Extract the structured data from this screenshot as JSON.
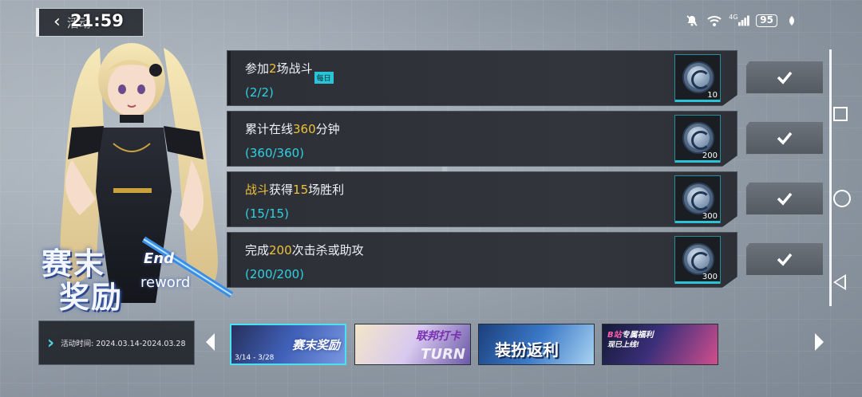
{
  "header": {
    "title": "活动",
    "time": "21:59"
  },
  "status_bar": {
    "battery": "95",
    "network": "4G",
    "icons": [
      "mute-bell-icon",
      "wifi-icon",
      "signal-icon",
      "battery-icon",
      "leaf-icon"
    ]
  },
  "event_title": {
    "line1": "赛末",
    "line2": "奖励",
    "en_end": "End",
    "en_reward": "reword"
  },
  "activity": {
    "label": "活动时间: 2024.03.14-2024.03.28"
  },
  "tasks": [
    {
      "name_parts": [
        "参加",
        "2",
        "场战斗"
      ],
      "daily_tag": "每日",
      "progress": "(2/2)",
      "reward_qty": "10",
      "reward_icon": "coin-icon"
    },
    {
      "name_parts": [
        "累计在线",
        "360",
        "分钟"
      ],
      "progress": "(360/360)",
      "reward_qty": "200",
      "reward_icon": "coin-icon"
    },
    {
      "name_parts": [
        "",
        "战斗",
        "获得",
        "15",
        "场胜利"
      ],
      "progress": "(15/15)",
      "reward_qty": "300",
      "reward_icon": "coin-icon"
    },
    {
      "name_parts": [
        "完成",
        "200",
        "次击杀或助攻"
      ],
      "progress": "(200/200)",
      "reward_qty": "300",
      "reward_icon": "coin-icon"
    }
  ],
  "banners": [
    {
      "label": "赛末奖励",
      "date": "3/14 - 3/28"
    },
    {
      "label": "联邦打卡",
      "sub": "TURN"
    },
    {
      "label": "装扮返利"
    },
    {
      "label_prefix": "B站",
      "label": "专属福利",
      "sub": "现已上线!"
    }
  ],
  "colors": {
    "accent_cyan": "#2fd0e4",
    "highlight_gold": "#f0c13a",
    "panel_dark": "#2c3036"
  }
}
